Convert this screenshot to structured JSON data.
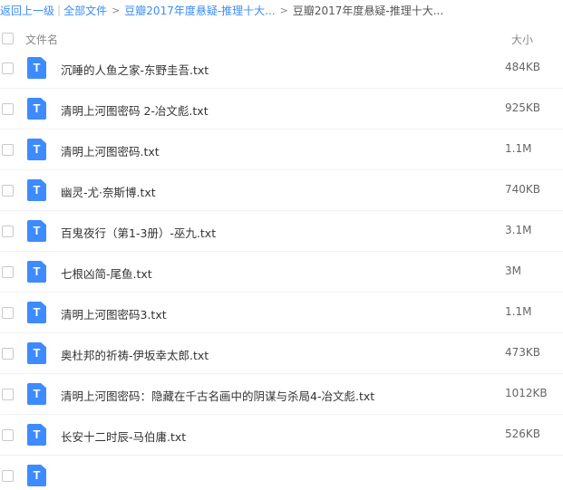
{
  "breadcrumb": {
    "back_label": "返回上一级",
    "sep": "|",
    "root_label": "全部文件",
    "parent_label": "豆瓣2017年度悬疑-推理十大...",
    "current_label": "豆瓣2017年度悬疑-推理十大...",
    "arrow": ">"
  },
  "header": {
    "name_label": "文件名",
    "size_label": "大小"
  },
  "icon_glyph": "T",
  "accent_color": "#3d8bff",
  "files": [
    {
      "name": "沉睡的人鱼之家-东野圭吾.txt",
      "size": "484KB"
    },
    {
      "name": "清明上河图密码 2-冶文彪.txt",
      "size": "925KB"
    },
    {
      "name": "清明上河图密码.txt",
      "size": "1.1M"
    },
    {
      "name": "幽灵-尤·奈斯博.txt",
      "size": "740KB"
    },
    {
      "name": "百鬼夜行（第1-3册）-巫九.txt",
      "size": "3.1M"
    },
    {
      "name": "七根凶简-尾鱼.txt",
      "size": "3M"
    },
    {
      "name": "清明上河图密码3.txt",
      "size": "1.1M"
    },
    {
      "name": "奥杜邦的祈祷-伊坂幸太郎.txt",
      "size": "473KB"
    },
    {
      "name": "清明上河图密码：隐藏在千古名画中的阴谋与杀局4-冶文彪.txt",
      "size": "1012KB"
    },
    {
      "name": "长安十二时辰-马伯庸.txt",
      "size": "526KB"
    },
    {
      "name": "",
      "size": ""
    }
  ]
}
